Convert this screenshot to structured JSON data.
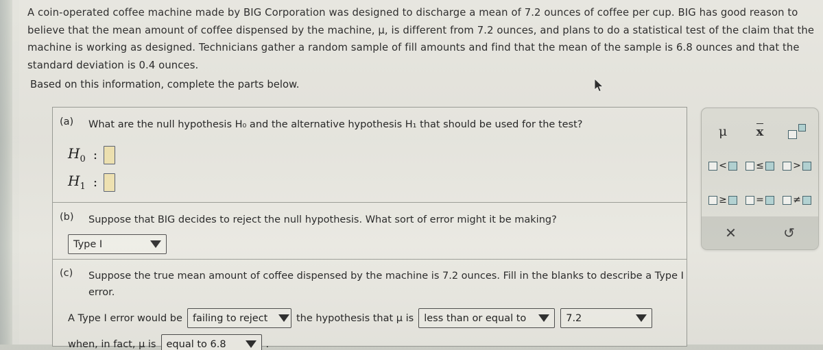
{
  "problem": {
    "intro": "A coin-operated coffee machine made by BIG Corporation was designed to discharge a mean of 7.2 ounces of coffee per cup. BIG has good reason to believe that the mean amount of coffee dispensed by the machine, μ, is different from 7.2 ounces, and plans to do a statistical test of the claim that the machine is working as designed. Technicians gather a random sample of fill amounts and find that the mean of the sample is 6.8 ounces and that the standard deviation is 0.4 ounces.",
    "instruction": "Based on this information, complete the parts below."
  },
  "parts": {
    "a": {
      "label": "(a)",
      "question": "What are the null hypothesis H₀ and the alternative hypothesis H₁ that should be used for the test?",
      "hypotheses": [
        {
          "name": "H",
          "subscript": "0",
          "colon": ":",
          "value": ""
        },
        {
          "name": "H",
          "subscript": "1",
          "colon": ":",
          "value": ""
        }
      ]
    },
    "b": {
      "label": "(b)",
      "question": "Suppose that BIG decides to reject the null hypothesis. What sort of error might it be making?",
      "error_type_value": "Type I"
    },
    "c": {
      "label": "(c)",
      "question": "Suppose the true mean amount of coffee dispensed by the machine is 7.2 ounces. Fill in the blanks to describe a Type I error.",
      "sentence_prefix": "A Type I error would be",
      "reject_value": "failing to reject",
      "sentence_mid": "the hypothesis that μ is",
      "relation_value": "less than or equal to",
      "number_value": "7.2",
      "sentence_second_prefix": "when, in fact, μ is",
      "truth_value": "equal to 6.8",
      "sentence_end": "."
    }
  },
  "math_palette": {
    "rows": [
      [
        {
          "key": "mu",
          "text": "μ"
        },
        {
          "key": "x-bar",
          "text": "x"
        },
        {
          "key": "power",
          "text": ""
        }
      ],
      [
        {
          "key": "less-than",
          "op": "<"
        },
        {
          "key": "less-than-or-equal",
          "op": "≤"
        },
        {
          "key": "greater-than",
          "op": ">"
        }
      ],
      [
        {
          "key": "greater-than-or-equal",
          "op": "≥"
        },
        {
          "key": "equals",
          "op": "="
        },
        {
          "key": "not-equal",
          "op": "≠"
        }
      ]
    ],
    "footer": {
      "clear": "✕",
      "undo": "↺"
    }
  },
  "colors": {
    "answer_box_fill": "#f0e3b2",
    "answer_box_border": "#5a6172",
    "palette_tile_fill": "#b3d3d3",
    "page_background": "#e6e5de"
  }
}
